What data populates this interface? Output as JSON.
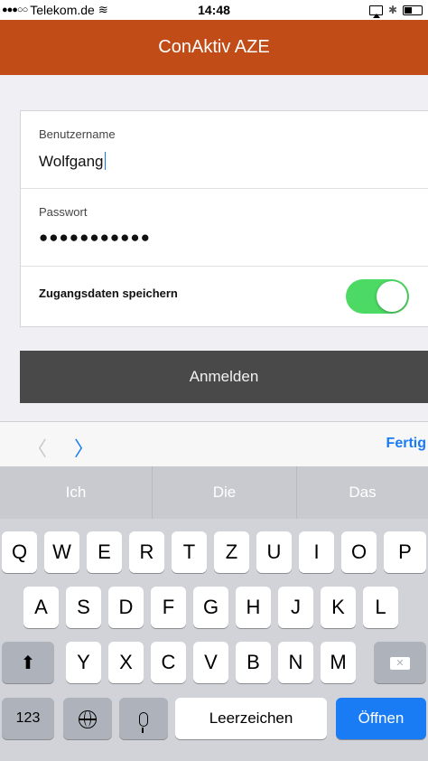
{
  "status_bar": {
    "carrier": "Telekom.de",
    "signal": "●●●○○",
    "time": "14:48"
  },
  "nav": {
    "title": "ConAktiv AZE"
  },
  "form": {
    "username_label": "Benutzername",
    "username_value": "Wolfgang",
    "password_label": "Passwort",
    "password_value": "●●●●●●●●●●●",
    "save_label": "Zugangsdaten speichern",
    "save_enabled": true
  },
  "login_button": "Anmelden",
  "accessory": {
    "prev": "〈",
    "next": "〉",
    "done": "Fertig"
  },
  "predictions": [
    "Ich",
    "Die",
    "Das"
  ],
  "keyboard": {
    "row1": [
      "Q",
      "W",
      "E",
      "R",
      "T",
      "Z",
      "U",
      "I",
      "O",
      "P"
    ],
    "row2": [
      "A",
      "S",
      "D",
      "F",
      "G",
      "H",
      "J",
      "K",
      "L"
    ],
    "row3": [
      "Y",
      "X",
      "C",
      "V",
      "B",
      "N",
      "M"
    ],
    "numbers": "123",
    "space": "Leerzeichen",
    "return": "Öffnen"
  },
  "colors": {
    "nav_bg": "#c14c17",
    "toggle_on": "#4cd964",
    "login_bg": "#494949",
    "accent": "#1a7cf5"
  },
  "icons": [
    "wifi-icon",
    "airplay-icon",
    "bluetooth-icon",
    "battery-icon",
    "chevron-left-icon",
    "chevron-right-icon",
    "globe-icon",
    "microphone-icon",
    "shift-icon",
    "backspace-icon"
  ]
}
